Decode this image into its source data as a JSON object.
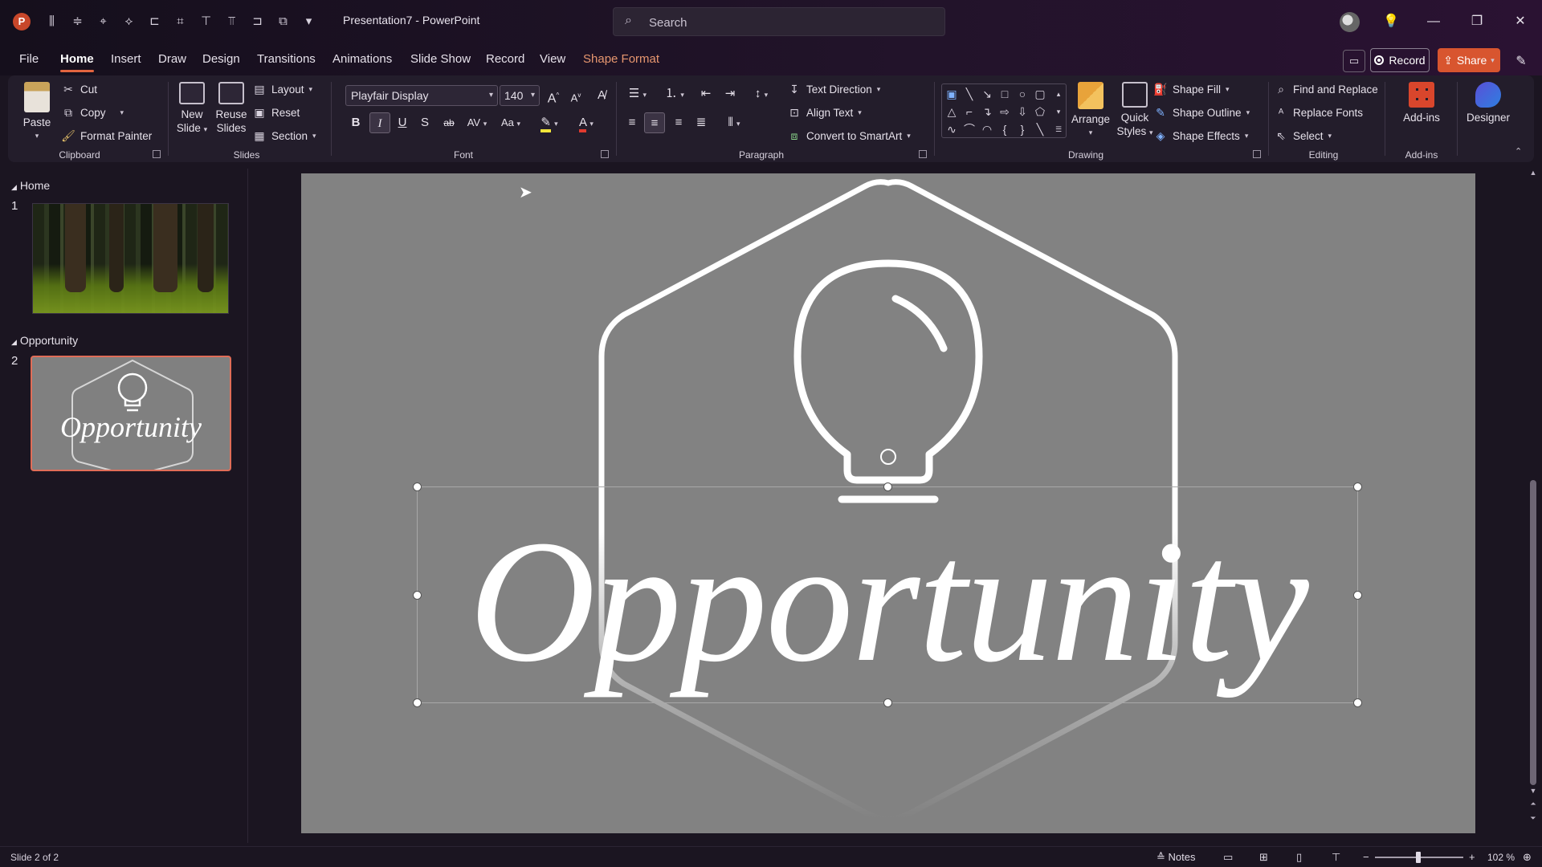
{
  "app": {
    "logo_letter": "P",
    "document_title": "Presentation7  -  PowerPoint",
    "search_placeholder": "Search"
  },
  "quick_access": [
    {
      "icon": "align-center-vertical-icon",
      "glyph": "⫼"
    },
    {
      "icon": "align-middle-icon",
      "glyph": "≑"
    },
    {
      "icon": "shape-edit-icon",
      "glyph": "⌖"
    },
    {
      "icon": "format-painter-icon",
      "glyph": "⟡"
    },
    {
      "icon": "align-left-icon",
      "glyph": "⊏"
    },
    {
      "icon": "crop-icon",
      "glyph": "⌗"
    },
    {
      "icon": "align-top-icon",
      "glyph": "⊤"
    },
    {
      "icon": "distribute-icon",
      "glyph": "⫪"
    },
    {
      "icon": "align-right-icon",
      "glyph": "⊐"
    },
    {
      "icon": "group-icon",
      "glyph": "⧉"
    },
    {
      "icon": "customize-dropdown-icon",
      "glyph": "▾"
    }
  ],
  "window_controls": {
    "minimize": "—",
    "restore": "❐",
    "close": "✕",
    "idea": "💡"
  },
  "tabs": [
    {
      "label": "File",
      "active": false,
      "contextual": false
    },
    {
      "label": "Home",
      "active": true,
      "contextual": false
    },
    {
      "label": "Insert",
      "active": false,
      "contextual": false
    },
    {
      "label": "Draw",
      "active": false,
      "contextual": false
    },
    {
      "label": "Design",
      "active": false,
      "contextual": false
    },
    {
      "label": "Transitions",
      "active": false,
      "contextual": false
    },
    {
      "label": "Animations",
      "active": false,
      "contextual": false
    },
    {
      "label": "Slide Show",
      "active": false,
      "contextual": false
    },
    {
      "label": "Record",
      "active": false,
      "contextual": false
    },
    {
      "label": "View",
      "active": false,
      "contextual": false
    },
    {
      "label": "Shape Format",
      "active": false,
      "contextual": true
    }
  ],
  "top_right": {
    "record_label": "Record",
    "share_label": "Share"
  },
  "ribbon": {
    "clipboard": {
      "paste": "Paste",
      "cut": "Cut",
      "copy": "Copy",
      "format_painter": "Format Painter",
      "label": "Clipboard"
    },
    "slides": {
      "new_slide_1": "New",
      "new_slide_2": "Slide",
      "reuse_1": "Reuse",
      "reuse_2": "Slides",
      "layout": "Layout",
      "reset": "Reset",
      "section": "Section",
      "label": "Slides"
    },
    "font": {
      "family": "Playfair Display",
      "size": "140",
      "bold": "B",
      "italic": "I",
      "underline": "U",
      "shadow": "S",
      "strike": "ab",
      "spacing": "AV",
      "case": "Aa",
      "grow": "A",
      "shrink": "A",
      "label": "Font"
    },
    "paragraph": {
      "text_direction": "Text Direction",
      "align_text": "Align Text",
      "convert_smartart": "Convert to SmartArt",
      "label": "Paragraph"
    },
    "drawing": {
      "arrange": "Arrange",
      "quick_1": "Quick",
      "quick_2": "Styles",
      "shape_fill": "Shape Fill",
      "shape_outline": "Shape Outline",
      "shape_effects": "Shape Effects",
      "label": "Drawing"
    },
    "editing": {
      "find_replace": "Find and Replace",
      "replace_fonts": "Replace Fonts",
      "select": "Select",
      "label": "Editing"
    },
    "addins": {
      "addins": "Add-ins",
      "label": "Add-ins"
    },
    "designer": {
      "designer": "Designer"
    }
  },
  "thumbnails": {
    "sections": [
      {
        "name": "Home",
        "slide_number": "1"
      },
      {
        "name": "Opportunity",
        "slide_number": "2",
        "thumb_text": "Opportunity"
      }
    ]
  },
  "slide": {
    "word": "Opportunity"
  },
  "status": {
    "slide_of": "Slide 2 of 2",
    "notes": "Notes",
    "zoom": "102 %",
    "zoom_minus": "−",
    "zoom_plus": "+"
  },
  "colors": {
    "accent": "#e3653f",
    "share": "#d8552f",
    "slide_bg": "#828282",
    "thumb_selected": "#e06d58"
  }
}
